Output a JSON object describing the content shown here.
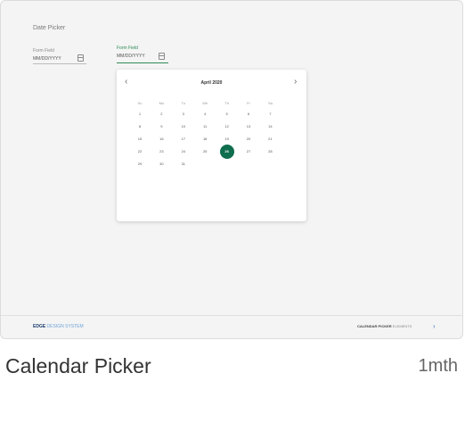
{
  "preview": {
    "section_title": "Date Picker",
    "field1": {
      "label": "Form Field",
      "placeholder": "MM/DD/YYYY"
    },
    "field2": {
      "label": "Form Field",
      "placeholder": "MM/DD/YYYY"
    },
    "calendar": {
      "prev_icon": "‹",
      "next_icon": "›",
      "month_label": "April 2020",
      "weekdays": [
        "Su",
        "Mo",
        "Tu",
        "We",
        "Th",
        "Fr",
        "Sa"
      ],
      "weeks": [
        [
          "1",
          "2",
          "3",
          "4",
          "5",
          "6",
          "7"
        ],
        [
          "8",
          "9",
          "10",
          "11",
          "12",
          "13",
          "14"
        ],
        [
          "15",
          "16",
          "17",
          "18",
          "19",
          "20",
          "21"
        ],
        [
          "22",
          "23",
          "24",
          "25",
          "26",
          "27",
          "28"
        ],
        [
          "29",
          "30",
          "31",
          "",
          "",
          "",
          ""
        ]
      ],
      "selected_day": "26",
      "accent_color": "#0f6e4e"
    },
    "footer": {
      "brand_bold": "EDGE",
      "brand_rest": " DESIGN SYSTEM",
      "breadcrumb_bold": "CALENDAR PICKER",
      "breadcrumb_rest": " ELEMENTS",
      "chevron_icon": "›"
    }
  },
  "card": {
    "title": "Calendar Picker",
    "age": "1mth"
  }
}
